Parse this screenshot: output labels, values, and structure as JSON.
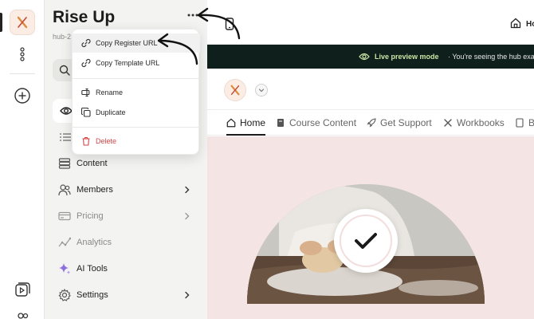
{
  "hub": {
    "title": "Rise Up",
    "slug": "hub-2"
  },
  "dropdown": {
    "items": [
      {
        "label": "Copy Register URL",
        "icon": "link-icon"
      },
      {
        "label": "Copy Template URL",
        "icon": "link-icon"
      },
      {
        "label": "Rename",
        "icon": "rename-icon"
      },
      {
        "label": "Duplicate",
        "icon": "duplicate-icon"
      },
      {
        "label": "Delete",
        "icon": "trash-icon",
        "color": "#d04545"
      }
    ]
  },
  "sidebar": {
    "items": [
      {
        "label": "Content",
        "icon": "database-icon",
        "has_chevron": false,
        "muted": false
      },
      {
        "label": "Members",
        "icon": "members-icon",
        "has_chevron": true,
        "muted": false
      },
      {
        "label": "Pricing",
        "icon": "credit-card-icon",
        "has_chevron": true,
        "muted": true
      },
      {
        "label": "Analytics",
        "icon": "analytics-icon",
        "has_chevron": false,
        "muted": true
      },
      {
        "label": "AI Tools",
        "icon": "sparkle-icon",
        "has_chevron": false,
        "muted": false
      },
      {
        "label": "Settings",
        "icon": "gear-icon",
        "has_chevron": true,
        "muted": false
      }
    ]
  },
  "preview": {
    "home_label": "Ho",
    "banner_strong": "Live preview mode",
    "banner_text": "· You're seeing the hub exact",
    "tabs": [
      {
        "label": "Home",
        "icon": "home-icon",
        "active": true
      },
      {
        "label": "Course Content",
        "icon": "book-icon",
        "active": false
      },
      {
        "label": "Get Support",
        "icon": "rocket-icon",
        "active": false
      },
      {
        "label": "Workbooks",
        "icon": "tools-icon",
        "active": false
      },
      {
        "label": "Bl",
        "icon": "book-icon",
        "active": false
      }
    ]
  },
  "colors": {
    "accent_green": "#c9e6a6",
    "banner_bg": "#0f1f1c",
    "hero_bg": "#f4e4e3",
    "danger": "#d04545"
  }
}
